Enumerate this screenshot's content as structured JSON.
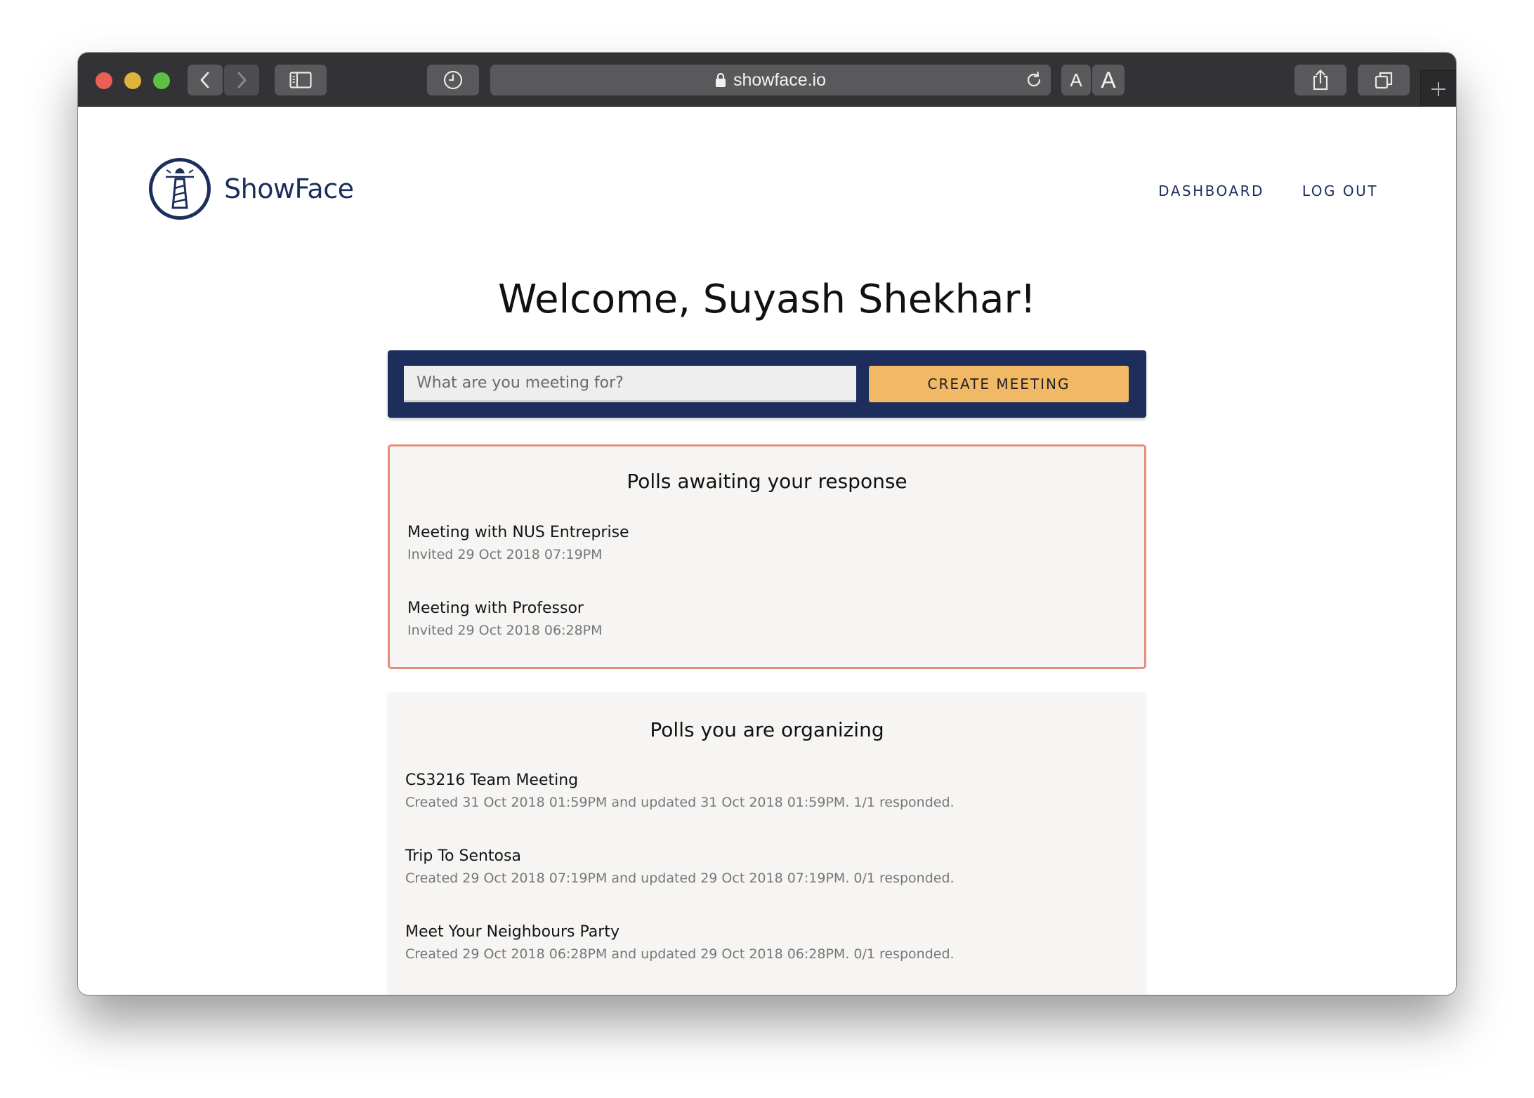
{
  "browser": {
    "url": "showface.io",
    "text_size_small_label": "A",
    "text_size_large_label": "A"
  },
  "brand": {
    "name": "ShowFace",
    "color": "#1d2e5c",
    "accent": "#f1b866",
    "alert_border": "#e58d7a"
  },
  "nav": {
    "dashboard": "DASHBOARD",
    "logout": "LOG OUT"
  },
  "welcome": "Welcome, Suyash Shekhar!",
  "create": {
    "placeholder": "What are you meeting for?",
    "value": "",
    "button": "CREATE MEETING"
  },
  "awaiting": {
    "title": "Polls awaiting your response",
    "polls": [
      {
        "title": "Meeting with NUS Entreprise",
        "meta": "Invited 29 Oct 2018 07:19PM"
      },
      {
        "title": "Meeting with Professor",
        "meta": "Invited 29 Oct 2018 06:28PM"
      }
    ]
  },
  "organizing": {
    "title": "Polls you are organizing",
    "polls": [
      {
        "title": "CS3216 Team Meeting",
        "meta": "Created 31 Oct 2018 01:59PM and updated 31 Oct 2018 01:59PM. 1/1 responded."
      },
      {
        "title": "Trip To Sentosa",
        "meta": "Created 29 Oct 2018 07:19PM and updated 29 Oct 2018 07:19PM. 0/1 responded."
      },
      {
        "title": "Meet Your Neighbours Party",
        "meta": "Created 29 Oct 2018 06:28PM and updated 29 Oct 2018 06:28PM. 0/1 responded."
      }
    ]
  }
}
